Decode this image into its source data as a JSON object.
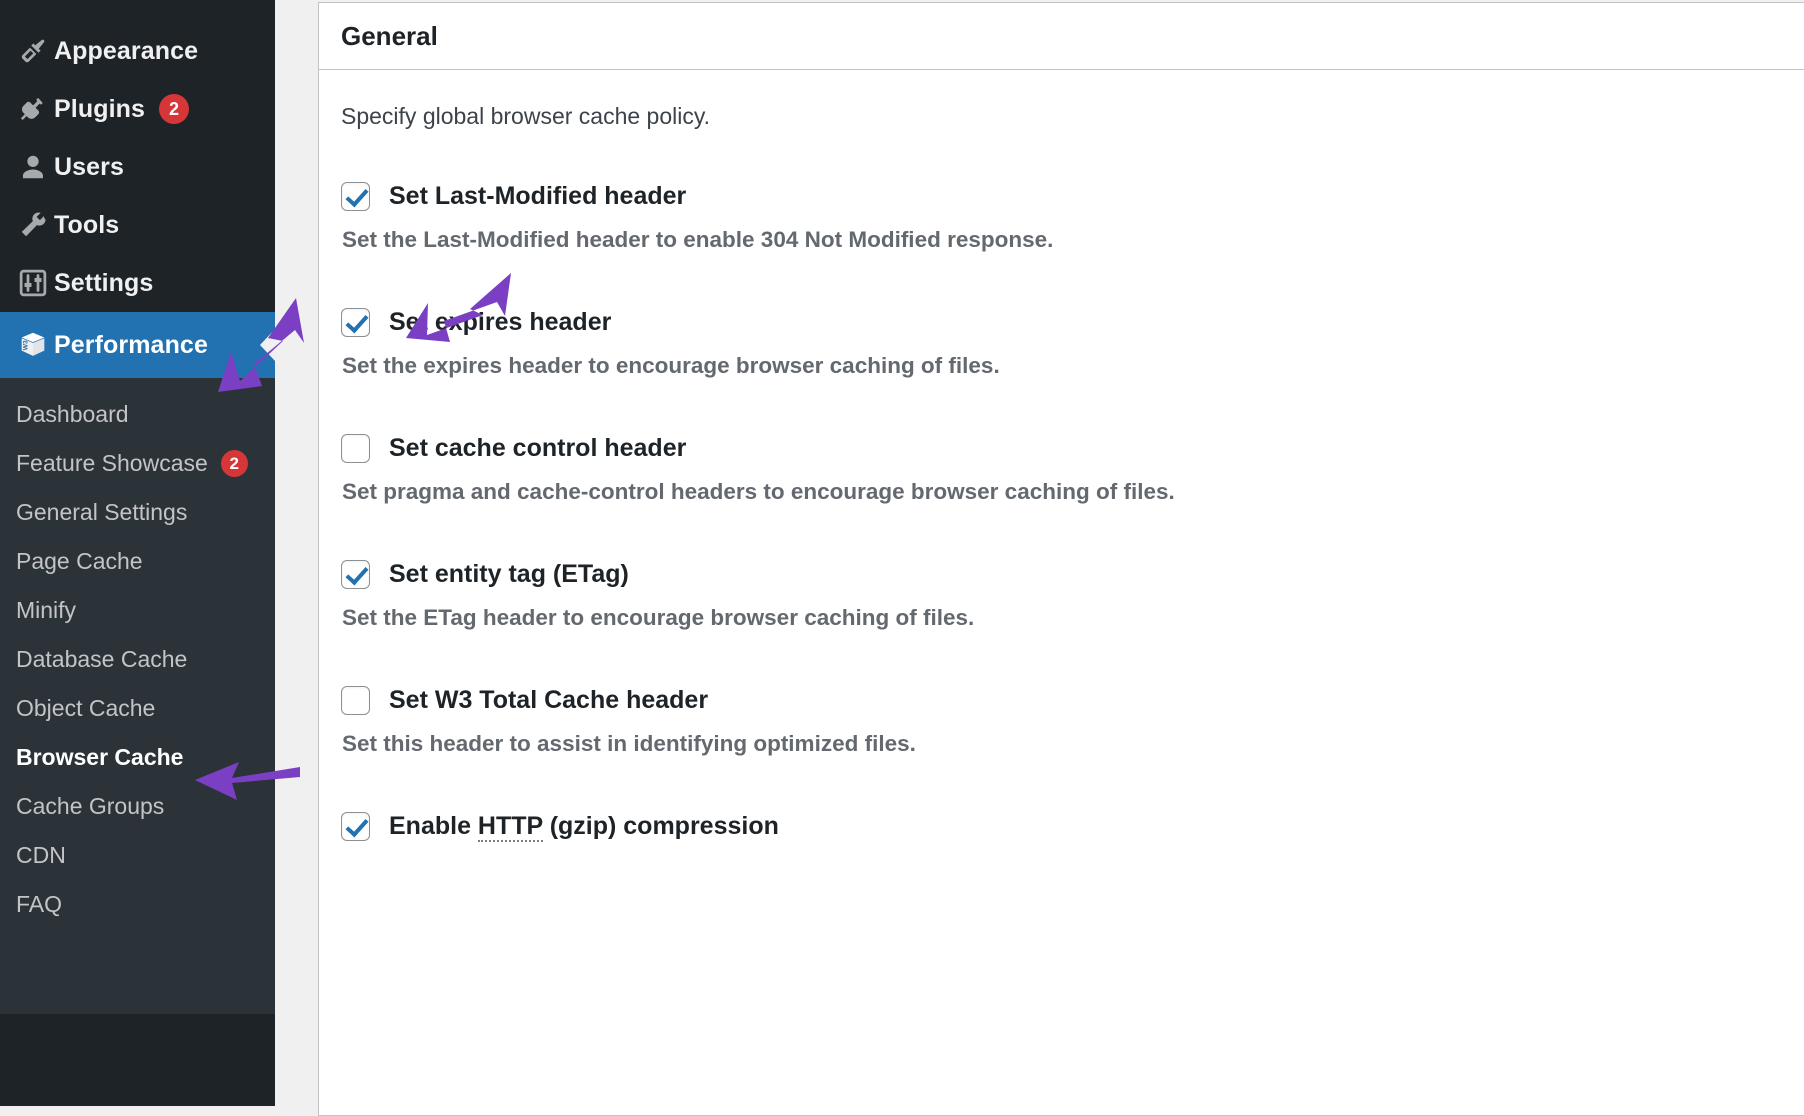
{
  "sidebar": {
    "top_items": [
      {
        "label": "Appearance",
        "icon": "paintbrush-icon",
        "badge": null
      },
      {
        "label": "Plugins",
        "icon": "plug-icon",
        "badge": "2"
      },
      {
        "label": "Users",
        "icon": "user-icon",
        "badge": null
      },
      {
        "label": "Tools",
        "icon": "wrench-icon",
        "badge": null
      },
      {
        "label": "Settings",
        "icon": "sliders-icon",
        "badge": null
      }
    ],
    "current_item": {
      "label": "Performance",
      "icon": "w3-total-cache-cube-icon"
    },
    "submenu": [
      {
        "label": "Dashboard",
        "badge": null,
        "current": false
      },
      {
        "label": "Feature Showcase",
        "badge": "2",
        "current": false
      },
      {
        "label": "General Settings",
        "badge": null,
        "current": false
      },
      {
        "label": "Page Cache",
        "badge": null,
        "current": false
      },
      {
        "label": "Minify",
        "badge": null,
        "current": false
      },
      {
        "label": "Database Cache",
        "badge": null,
        "current": false
      },
      {
        "label": "Object Cache",
        "badge": null,
        "current": false
      },
      {
        "label": "Browser Cache",
        "badge": null,
        "current": true
      },
      {
        "label": "Cache Groups",
        "badge": null,
        "current": false
      },
      {
        "label": "CDN",
        "badge": null,
        "current": false
      },
      {
        "label": "FAQ",
        "badge": null,
        "current": false
      }
    ]
  },
  "panel": {
    "title": "General",
    "intro": "Specify global browser cache policy.",
    "fields": [
      {
        "label": "Set Last-Modified header",
        "description": "Set the Last-Modified header to enable 304 Not Modified response.",
        "checked": true
      },
      {
        "label": "Set expires header",
        "description": "Set the expires header to encourage browser caching of files.",
        "checked": true
      },
      {
        "label": "Set cache control header",
        "description": "Set pragma and cache-control headers to encourage browser caching of files.",
        "checked": false
      },
      {
        "label": "Set entity tag (ETag)",
        "description": "Set the ETag header to encourage browser caching of files.",
        "checked": true
      },
      {
        "label": "Set W3 Total Cache header",
        "description": "Set this header to assist in identifying optimized files.",
        "checked": false
      },
      {
        "label_prefix": "Enable ",
        "label_abbr": "HTTP",
        "label_suffix": " (gzip) compression",
        "description": "",
        "checked": true
      }
    ]
  },
  "colors": {
    "sidebar_bg": "#1d2327",
    "submenu_bg": "#2c3338",
    "accent_blue": "#2271b1",
    "badge_red": "#d63638",
    "annotation_purple": "#7b3fc4",
    "checkbox_check": "#2271b1",
    "page_bg": "#f0f0f1"
  },
  "annotations": [
    {
      "name": "arrow-to-performance",
      "target": "Performance"
    },
    {
      "name": "arrow-to-set-expires-header",
      "target": "Set expires header"
    },
    {
      "name": "arrow-to-browser-cache",
      "target": "Browser Cache"
    }
  ]
}
